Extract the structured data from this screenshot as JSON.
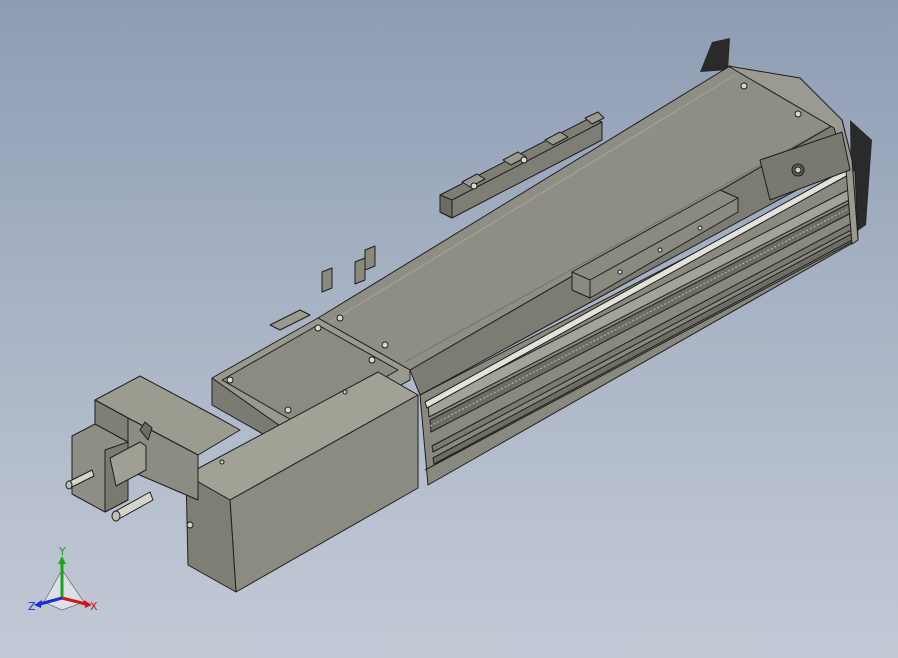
{
  "viewport": {
    "background_top": "#8e9cb3",
    "background_bottom": "#c3cad6",
    "model_fill": "#8c8b80",
    "model_edge": "#1e1e1e"
  },
  "triad": {
    "x_label": "X",
    "y_label": "Y",
    "z_label": "Z",
    "x_color": "#d01818",
    "y_color": "#1aa51a",
    "z_color": "#1a2fd0"
  }
}
